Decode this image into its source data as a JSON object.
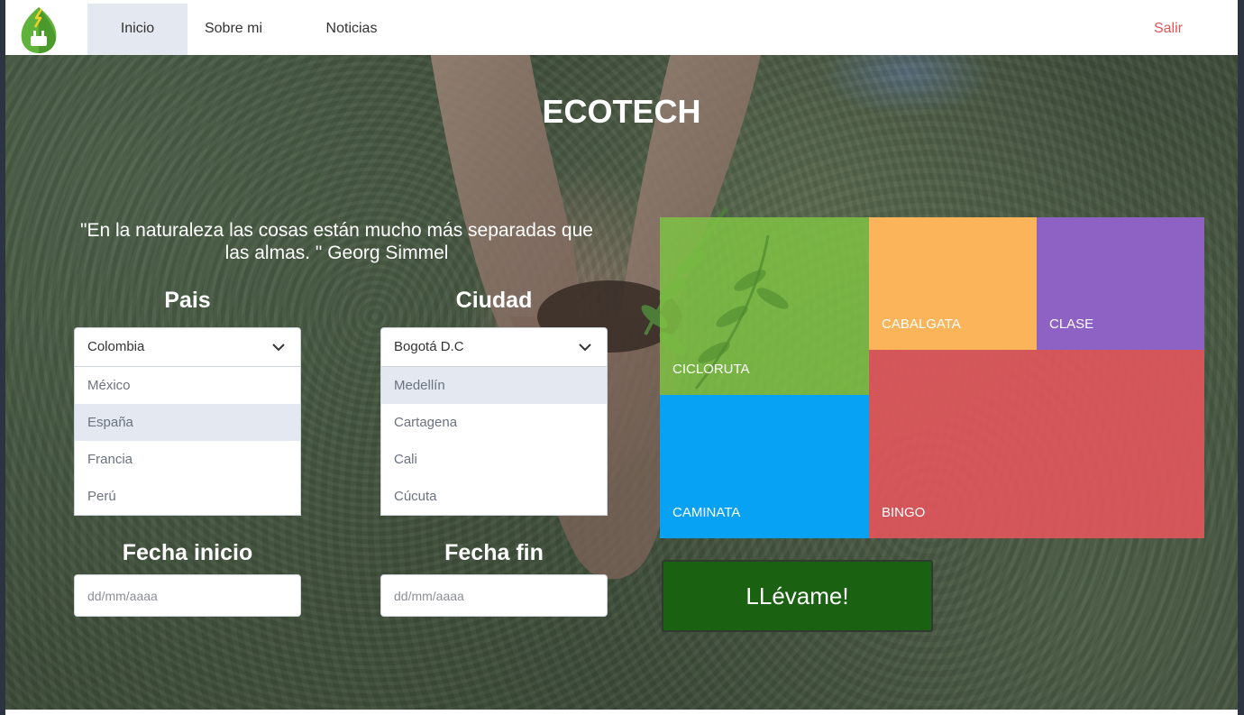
{
  "nav": {
    "items": [
      {
        "label": "Inicio",
        "active": true
      },
      {
        "label": "Sobre mi",
        "active": false
      },
      {
        "label": "Noticias",
        "active": false
      }
    ],
    "logout": "Salir"
  },
  "hero": {
    "title": "ECOTECH",
    "quote_line1": "\"En la naturaleza las cosas están mucho más separadas que",
    "quote_line2": "las almas. \" Georg Simmel"
  },
  "form": {
    "country": {
      "label": "Pais",
      "selected": "Colombia",
      "options": [
        "México",
        "España",
        "Francia",
        "Perú"
      ],
      "highlighted": "España"
    },
    "city": {
      "label": "Ciudad",
      "selected": "Bogotá D.C",
      "options": [
        "Medellín",
        "Cartagena",
        "Cali",
        "Cúcuta"
      ],
      "highlighted": "Medellín"
    },
    "start_date": {
      "label": "Fecha inicio",
      "placeholder": "dd/mm/aaaa"
    },
    "end_date": {
      "label": "Fecha fin",
      "placeholder": "dd/mm/aaaa"
    }
  },
  "activities": [
    {
      "label": "CICLORUTA",
      "color": "#7fc244"
    },
    {
      "label": "CABALGATA",
      "color": "#fbb45a"
    },
    {
      "label": "CLASE",
      "color": "#8e61c4"
    },
    {
      "label": "CAMINATA",
      "color": "#07a2f4"
    },
    {
      "label": "BINGO",
      "color": "#e0565b"
    }
  ],
  "cta": {
    "label": "LLévame!",
    "color": "#1a6212"
  },
  "colors": {
    "accent_logout": "#e0565b",
    "nav_active": "#e4e8f0"
  }
}
